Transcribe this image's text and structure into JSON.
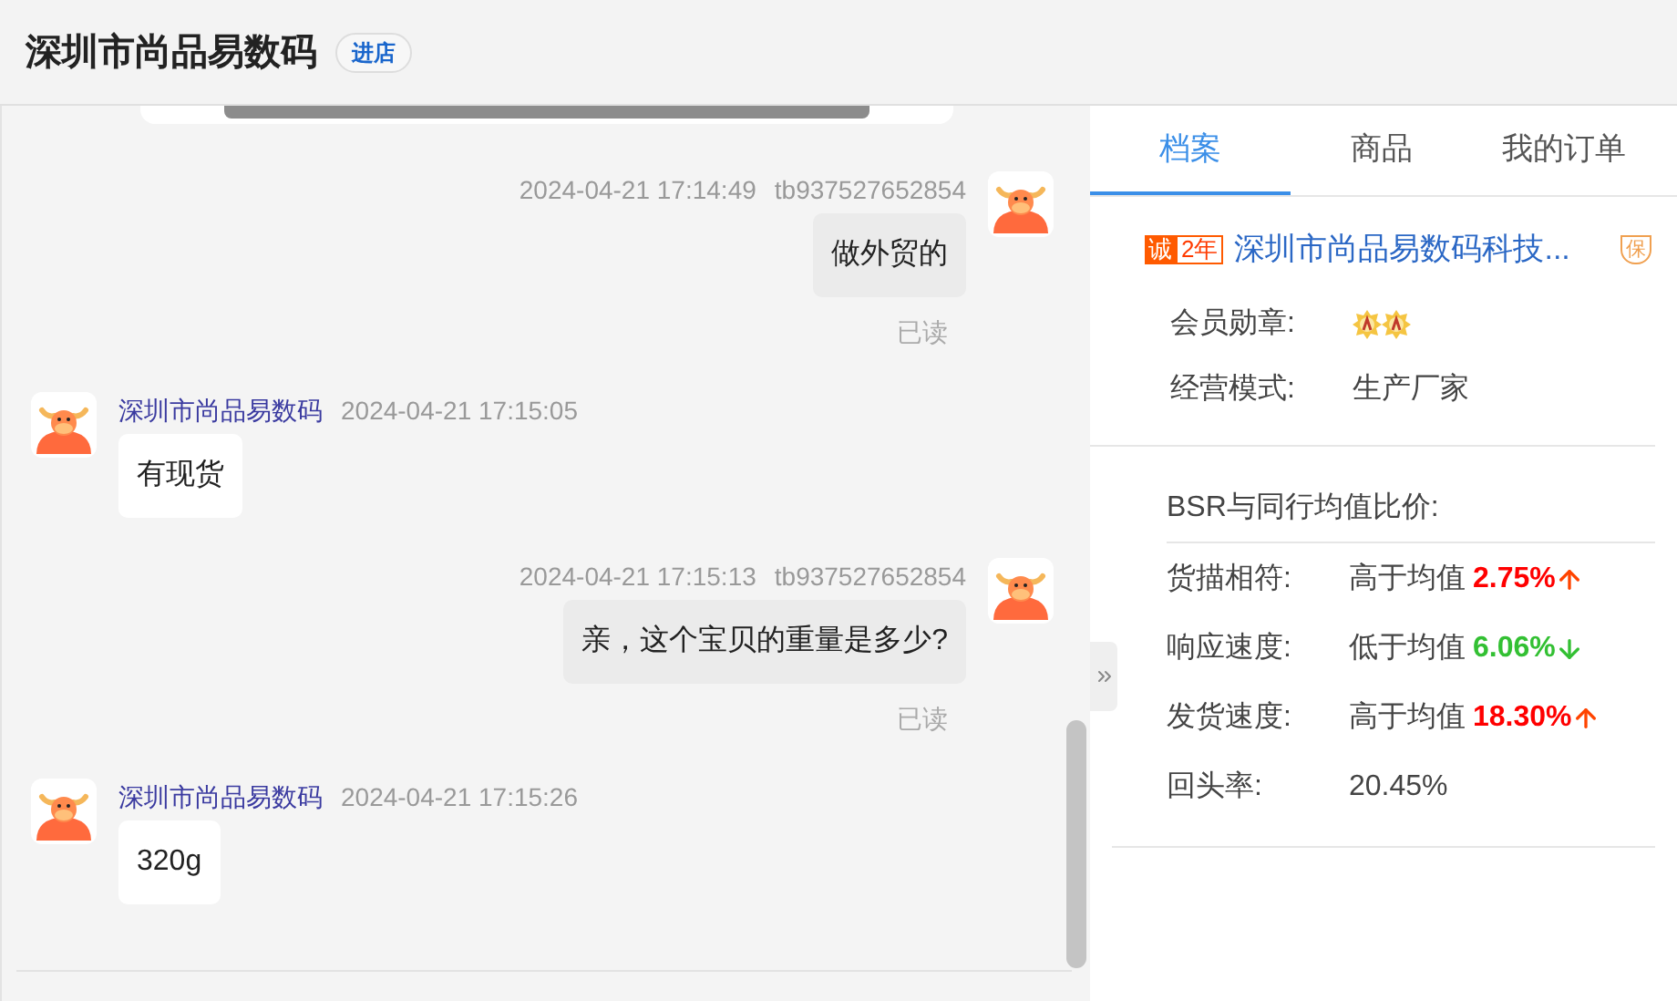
{
  "header": {
    "title": "深圳市尚品易数码",
    "store_button": "进店"
  },
  "messages": [
    {
      "kind": "sent",
      "time": "2024-04-21 17:14:49",
      "user": "tb937527652854",
      "text": "做外贸的",
      "status": "已读"
    },
    {
      "kind": "received",
      "sender": "深圳市尚品易数码",
      "time": "2024-04-21 17:15:05",
      "text": "有现货"
    },
    {
      "kind": "sent",
      "time": "2024-04-21 17:15:13",
      "user": "tb937527652854",
      "text": "亲，这个宝贝的重量是多少?",
      "status": "已读"
    },
    {
      "kind": "received",
      "sender": "深圳市尚品易数码",
      "time": "2024-04-21 17:15:26",
      "text": "320g"
    }
  ],
  "tabs": [
    {
      "label": "档案",
      "selected": true
    },
    {
      "label": "商品",
      "selected": false
    },
    {
      "label": "我的订单",
      "selected": false
    }
  ],
  "profile": {
    "badge": "诚",
    "years": "2年",
    "shop_name": "深圳市尚品易数码科技...",
    "guarantee": "保",
    "rows": [
      {
        "kind": "medals",
        "label": "会员勋章:"
      },
      {
        "kind": "text",
        "label": "经营模式:",
        "value": "生产厂家"
      }
    ]
  },
  "bsr": {
    "title": "BSR与同行均值比价:",
    "metrics": [
      {
        "label": "货描相符:",
        "comparison": "高于均值",
        "value": "2.75%",
        "kind": "up"
      },
      {
        "label": "响应速度:",
        "comparison": "低于均值",
        "value": "6.06%",
        "kind": "down"
      },
      {
        "label": "发货速度:",
        "comparison": "高于均值",
        "value": "18.30%",
        "kind": "up"
      },
      {
        "label": "回头率:",
        "value": "20.45%",
        "kind": "plain"
      }
    ]
  }
}
